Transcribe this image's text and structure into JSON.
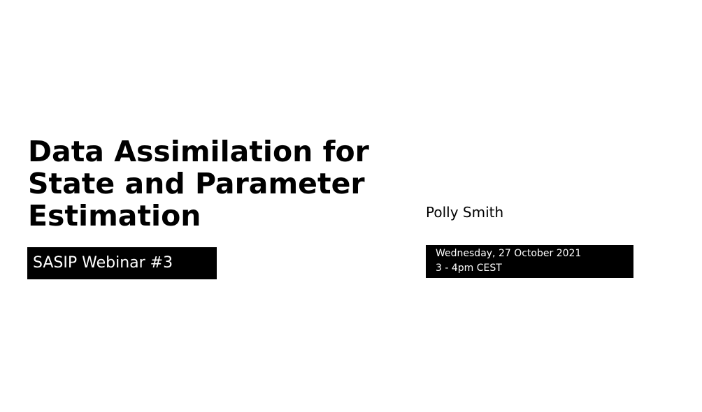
{
  "title": {
    "lines": [
      "Data Assimilation for",
      "State and Parameter",
      "Estimation"
    ]
  },
  "event": {
    "label": "SASIP Webinar #3"
  },
  "speaker": {
    "name": "Polly Smith"
  },
  "schedule": {
    "date": "Wednesday, 27 October 2021",
    "time": "3 - 4pm CEST"
  },
  "colors": {
    "background": "#ffffff",
    "text": "#000000",
    "badge_background": "#000000",
    "badge_text": "#ffffff"
  }
}
